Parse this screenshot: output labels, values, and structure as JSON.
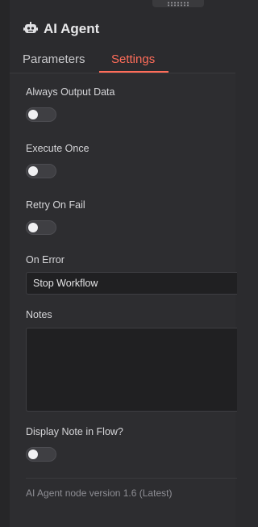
{
  "panel": {
    "title": "AI Agent",
    "title_icon": "robot-icon"
  },
  "tabs": [
    {
      "label": "Parameters",
      "active": false
    },
    {
      "label": "Settings",
      "active": true
    }
  ],
  "settings": {
    "always_output_data": {
      "label": "Always Output Data",
      "enabled": false
    },
    "execute_once": {
      "label": "Execute Once",
      "enabled": false
    },
    "retry_on_fail": {
      "label": "Retry On Fail",
      "enabled": false
    },
    "on_error": {
      "label": "On Error",
      "value": "Stop Workflow"
    },
    "notes": {
      "label": "Notes",
      "value": ""
    },
    "display_note_in_flow": {
      "label": "Display Note in Flow?",
      "enabled": false
    }
  },
  "footer": {
    "version_text": "AI Agent node version 1.6 (Latest)"
  },
  "colors": {
    "accent": "#ff6d5a",
    "background": "#2b2b2e",
    "input_background": "#202022"
  }
}
